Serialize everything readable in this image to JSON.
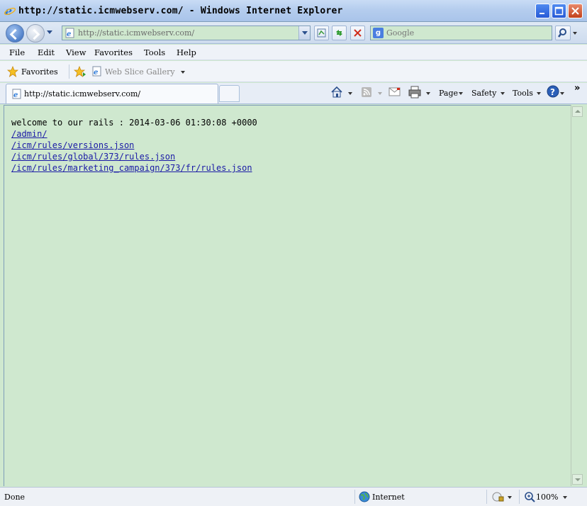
{
  "window": {
    "title": "http://static.icmwebserv.com/ - Windows Internet Explorer"
  },
  "address_bar": {
    "url": "http://static.icmwebserv.com/"
  },
  "search": {
    "placeholder": "Google"
  },
  "menu": {
    "items": [
      "File",
      "Edit",
      "View",
      "Favorites",
      "Tools",
      "Help"
    ]
  },
  "favorites_bar": {
    "favorites_label": "Favorites",
    "web_slice_label": "Web Slice Gallery"
  },
  "tabs": {
    "active_label": "http://static.icmwebserv.com/"
  },
  "command_bar": {
    "page": "Page",
    "safety": "Safety",
    "tools": "Tools",
    "more": "»"
  },
  "content": {
    "welcome": "welcome to our rails : 2014-03-06 01:30:08 +0000",
    "links": [
      "/admin/",
      "/icm/rules/versions.json",
      "/icm/rules/global/373/rules.json",
      "/icm/rules/marketing_campaign/373/fr/rules.json"
    ]
  },
  "status": {
    "text": "Done",
    "zone": "Internet",
    "zoom": "100%"
  },
  "colors": {
    "page_background": "#cfe8cf",
    "link": "#1a1aa6",
    "chrome": "#dfe9f5"
  }
}
